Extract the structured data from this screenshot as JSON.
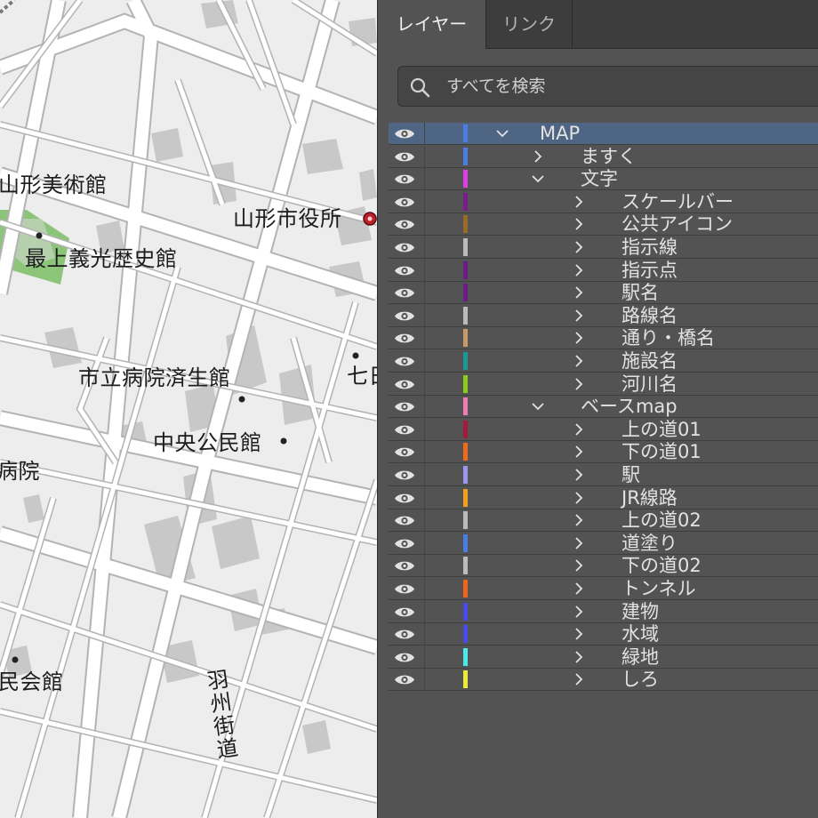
{
  "map": {
    "labels": {
      "art_museum": "山形美術館",
      "city_hall": "山形市役所",
      "history_museum": "最上義光歴史館",
      "hospital_saiseikan": "市立病院済生館",
      "community_center": "中央公民館",
      "hospital_partial": "病院",
      "hall_partial": "民会館",
      "shichi_partial": "七日",
      "ushu_kaido": "羽州街道"
    },
    "colors": {
      "background": "#ededed",
      "road": "#ffffff",
      "road_edge": "#b3b3b3",
      "building": "#c8c8c8",
      "park": "#8cc57a",
      "city_hall_marker": "#c0202a"
    }
  },
  "panel": {
    "tabs": [
      {
        "label": "レイヤー",
        "active": true
      },
      {
        "label": "リンク",
        "active": false
      }
    ],
    "search": {
      "placeholder": "すべてを検索",
      "icon": "search-icon"
    },
    "colors": {
      "panel_bg": "#535353",
      "tab_bar_bg": "#3d3d3d",
      "selected_row": "#4f6584",
      "text": "#e2e2e2"
    },
    "layers": [
      {
        "name": "MAP",
        "depth": 0,
        "expanded": true,
        "color": "#4a7de8",
        "selected": true,
        "visible": true
      },
      {
        "name": "ますく",
        "depth": 1,
        "expanded": false,
        "color": "#4a7de8",
        "visible": true
      },
      {
        "name": "文字",
        "depth": 1,
        "expanded": true,
        "color": "#e23ce6",
        "visible": true
      },
      {
        "name": "スケールバー",
        "depth": 2,
        "expanded": false,
        "color": "#7a1c8c",
        "visible": true
      },
      {
        "name": "公共アイコン",
        "depth": 2,
        "expanded": false,
        "color": "#9a6a2a",
        "visible": true
      },
      {
        "name": "指示線",
        "depth": 2,
        "expanded": false,
        "color": "#bbbbbb",
        "visible": true
      },
      {
        "name": "指示点",
        "depth": 2,
        "expanded": false,
        "color": "#6a1c8c",
        "visible": true
      },
      {
        "name": "駅名",
        "depth": 2,
        "expanded": false,
        "color": "#6a1c8c",
        "visible": true
      },
      {
        "name": "路線名",
        "depth": 2,
        "expanded": false,
        "color": "#bbbbbb",
        "visible": true
      },
      {
        "name": "通り・橋名",
        "depth": 2,
        "expanded": false,
        "color": "#c89a6a",
        "visible": true
      },
      {
        "name": "施設名",
        "depth": 2,
        "expanded": false,
        "color": "#1a9a96",
        "visible": true
      },
      {
        "name": "河川名",
        "depth": 2,
        "expanded": false,
        "color": "#8ccc1c",
        "visible": true
      },
      {
        "name": "ベースmap",
        "depth": 1,
        "expanded": true,
        "color": "#f07ab4",
        "visible": true
      },
      {
        "name": "上の道01",
        "depth": 2,
        "expanded": false,
        "color": "#a8183a",
        "visible": true
      },
      {
        "name": "下の道01",
        "depth": 2,
        "expanded": false,
        "color": "#f06a1c",
        "visible": true
      },
      {
        "name": "駅",
        "depth": 2,
        "expanded": false,
        "color": "#9a96f0",
        "visible": true
      },
      {
        "name": "JR線路",
        "depth": 2,
        "expanded": false,
        "color": "#f0a21c",
        "visible": true
      },
      {
        "name": "上の道02",
        "depth": 2,
        "expanded": false,
        "color": "#bbbbbb",
        "visible": true
      },
      {
        "name": "道塗り",
        "depth": 2,
        "expanded": false,
        "color": "#4a7de8",
        "visible": true
      },
      {
        "name": "下の道02",
        "depth": 2,
        "expanded": false,
        "color": "#bbbbbb",
        "visible": true
      },
      {
        "name": "トンネル",
        "depth": 2,
        "expanded": false,
        "color": "#f0641c",
        "visible": true
      },
      {
        "name": "建物",
        "depth": 2,
        "expanded": false,
        "color": "#4a4ae6",
        "visible": true
      },
      {
        "name": "水域",
        "depth": 2,
        "expanded": false,
        "color": "#4a4ae6",
        "visible": true
      },
      {
        "name": "緑地",
        "depth": 2,
        "expanded": false,
        "color": "#4aeaea",
        "visible": true
      },
      {
        "name": "しろ",
        "depth": 2,
        "expanded": false,
        "color": "#eaea3a",
        "visible": true
      }
    ]
  }
}
